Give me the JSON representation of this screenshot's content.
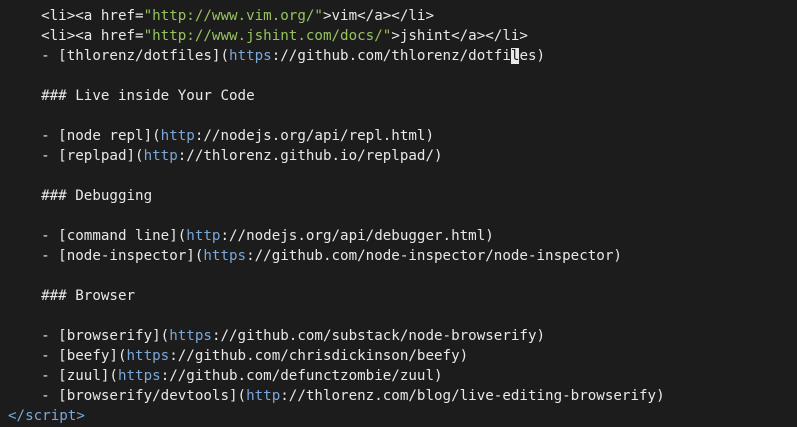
{
  "theme": {
    "background": "#1c1c1c",
    "foreground": "#e8e8e8",
    "string": "#97c35f",
    "scheme": "#7ba7d9",
    "cursor": "#e8e8e8"
  },
  "lines": [
    {
      "name": "code-line-1",
      "segments": [
        {
          "t": "  <li><a href=",
          "c": "tag"
        },
        {
          "t": "\"http://www.vim.org/\"",
          "c": "str"
        },
        {
          "t": ">vim</a></li>",
          "c": "tag"
        }
      ]
    },
    {
      "name": "code-line-2",
      "segments": [
        {
          "t": "  <li><a href=",
          "c": "tag"
        },
        {
          "t": "\"http://www.jshint.com/docs/\"",
          "c": "str"
        },
        {
          "t": ">jshint</a></li>",
          "c": "tag"
        }
      ]
    },
    {
      "name": "code-line-3",
      "segments": [
        {
          "t": "  - [thlorenz/dotfiles](",
          "c": "link"
        },
        {
          "t": "https",
          "c": "scheme"
        },
        {
          "t": "://github.com/thlorenz/dotfi",
          "c": "url"
        },
        {
          "t": "l",
          "c": "cursor"
        },
        {
          "t": "es)",
          "c": "url"
        }
      ]
    },
    {
      "name": "code-line-4",
      "segments": []
    },
    {
      "name": "code-line-5",
      "segments": [
        {
          "t": "  ### Live inside Your Code",
          "c": "link"
        }
      ]
    },
    {
      "name": "code-line-6",
      "segments": []
    },
    {
      "name": "code-line-7",
      "segments": [
        {
          "t": "  - [node repl](",
          "c": "link"
        },
        {
          "t": "http",
          "c": "scheme"
        },
        {
          "t": "://nodejs.org/api/repl.html)",
          "c": "url"
        }
      ]
    },
    {
      "name": "code-line-8",
      "segments": [
        {
          "t": "  - [replpad](",
          "c": "link"
        },
        {
          "t": "http",
          "c": "scheme"
        },
        {
          "t": "://thlorenz.github.io/replpad/)",
          "c": "url"
        }
      ]
    },
    {
      "name": "code-line-9",
      "segments": []
    },
    {
      "name": "code-line-10",
      "segments": [
        {
          "t": "  ### Debugging",
          "c": "link"
        }
      ]
    },
    {
      "name": "code-line-11",
      "segments": []
    },
    {
      "name": "code-line-12",
      "segments": [
        {
          "t": "  - [command line](",
          "c": "link"
        },
        {
          "t": "http",
          "c": "scheme"
        },
        {
          "t": "://nodejs.org/api/debugger.html)",
          "c": "url"
        }
      ]
    },
    {
      "name": "code-line-13",
      "segments": [
        {
          "t": "  - [node-inspector](",
          "c": "link"
        },
        {
          "t": "https",
          "c": "scheme"
        },
        {
          "t": "://github.com/node-inspector/node-inspector)",
          "c": "url"
        }
      ]
    },
    {
      "name": "code-line-14",
      "segments": []
    },
    {
      "name": "code-line-15",
      "segments": [
        {
          "t": "  ### Browser",
          "c": "link"
        }
      ]
    },
    {
      "name": "code-line-16",
      "segments": []
    },
    {
      "name": "code-line-17",
      "segments": [
        {
          "t": "  - [browserify](",
          "c": "link"
        },
        {
          "t": "https",
          "c": "scheme"
        },
        {
          "t": "://github.com/substack/node-browserify)",
          "c": "url"
        }
      ]
    },
    {
      "name": "code-line-18",
      "segments": [
        {
          "t": "  - [beefy](",
          "c": "link"
        },
        {
          "t": "https",
          "c": "scheme"
        },
        {
          "t": "://github.com/chrisdickinson/beefy)",
          "c": "url"
        }
      ]
    },
    {
      "name": "code-line-19",
      "segments": [
        {
          "t": "  - [zuul](",
          "c": "link"
        },
        {
          "t": "https",
          "c": "scheme"
        },
        {
          "t": "://github.com/defunctzombie/zuul)",
          "c": "url"
        }
      ]
    },
    {
      "name": "code-line-20",
      "segments": [
        {
          "t": "  - [browserify/devtools](",
          "c": "link"
        },
        {
          "t": "http",
          "c": "scheme"
        },
        {
          "t": "://thlorenz.com/blog/live-editing-browserify)",
          "c": "url"
        }
      ]
    },
    {
      "name": "code-line-21",
      "segments": [
        {
          "t": "</",
          "c": "script-tag"
        },
        {
          "t": "script",
          "c": "script-tag"
        },
        {
          "t": ">",
          "c": "script-tag"
        }
      ]
    }
  ]
}
